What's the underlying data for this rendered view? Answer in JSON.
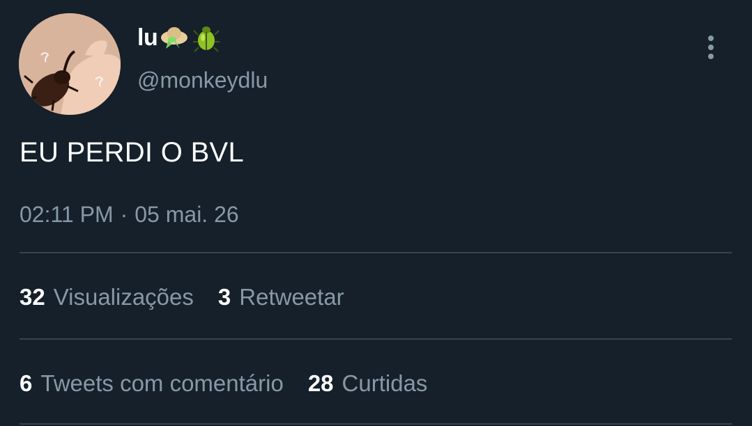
{
  "user": {
    "display_name": "lu",
    "handle": "@monkeydlu",
    "name_emojis": [
      "hat-with-bow-emoji",
      "beetle-emoji"
    ]
  },
  "tweet": {
    "text": "EU PERDI O BVL",
    "time": "02:11 PM",
    "separator": "·",
    "date": "05 mai. 26"
  },
  "stats": {
    "row1": [
      {
        "count": "32",
        "label": "Visualizações"
      },
      {
        "count": "3",
        "label": "Retweetar"
      }
    ],
    "row2": [
      {
        "count": "6",
        "label": "Tweets com comentário"
      },
      {
        "count": "28",
        "label": "Curtidas"
      }
    ]
  },
  "colors": {
    "background": "#15202b",
    "secondary_text": "#8899a6",
    "divider": "#38444d"
  }
}
